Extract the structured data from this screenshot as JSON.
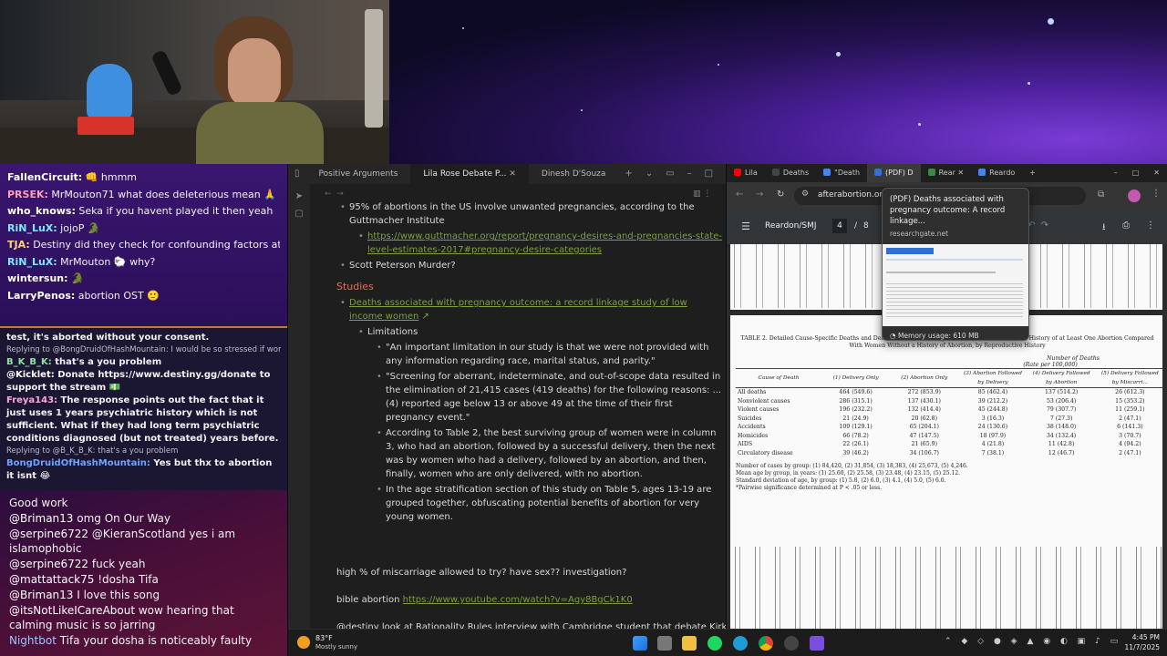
{
  "chat_top": [
    {
      "user": "FallenCircuit:",
      "color": "#ffffff",
      "text": " 👊 hmmm"
    },
    {
      "user": "PRSEK:",
      "color": "#ff9db3",
      "text": " MrMouton71 what does deleterious mean 🙏"
    },
    {
      "user": "who_knows:",
      "color": "#ffffff",
      "text": " Seka if you havent played it then yeah"
    },
    {
      "user": "RiN_LuX:",
      "color": "#7fe8ff",
      "text": " jojoP 🐊"
    },
    {
      "user": "TJA:",
      "color": "#ffd27f",
      "text": " Destiny did they check for confounding factors at all?"
    },
    {
      "user": "RiN_LuX:",
      "color": "#7fe8ff",
      "text": " MrMouton 🐑 why?"
    },
    {
      "user": "wintersun:",
      "color": "#ffffff",
      "text": " 🐊"
    },
    {
      "user": "LarryPenos:",
      "color": "#ffffff",
      "text": " abortion OST 🙂"
    }
  ],
  "chat_mid": [
    {
      "kind": "msg",
      "text": "test, it's aborted without your consent.",
      "color": "#f1f1f1"
    },
    {
      "kind": "reply",
      "text": "Replying to @BongDruidOfHashMountain: I would be so stressed if women d..."
    },
    {
      "kind": "msg",
      "user": "B_K_B_K:",
      "user_color": "#8fe3a0",
      "text": " that's a you problem"
    },
    {
      "kind": "msg",
      "user": "@Kicklet:",
      "user_color": "#ffffff",
      "text": " Donate https://www.destiny.gg/donate to support the stream 💵"
    },
    {
      "kind": "msg",
      "user": "Freya143:",
      "user_color": "#ffa6d8",
      "text": " The response points out the fact that it just uses 1 years psychiatric history which is not sufficient. What if they had long term psychiatric conditions diagnosed (but not treated) years before."
    },
    {
      "kind": "reply",
      "text": "Replying to @B_K_B_K: that's a you problem"
    },
    {
      "kind": "msg",
      "user": "BongDruidOfHashMountain:",
      "user_color": "#6ea4ff",
      "text": " Yes but thx to abortion it isnt 😂"
    }
  ],
  "chat_bottom": [
    {
      "user": "",
      "user_color": "#ffffff",
      "text": "Good work"
    },
    {
      "user": "@Briman13",
      "user_color": "#ffffff",
      "text": " omg On Our Way"
    },
    {
      "user": "@serpine6722",
      "user_color": "#ffffff",
      "text": " @KieranScotland yes i am islamophobic"
    },
    {
      "user": "@serpine6722",
      "user_color": "#ffffff",
      "text": " fuck yeah"
    },
    {
      "user": "@mattattack75",
      "user_color": "#ffffff",
      "text": " !dosha Tifa"
    },
    {
      "user": "@Briman13",
      "user_color": "#ffffff",
      "text": " I love this song"
    },
    {
      "user": "@itsNotLikeICareAbout",
      "user_color": "#ffffff",
      "text": " wow hearing that calming music is so jarring"
    },
    {
      "user": "Nightbot",
      "user_color": "#9cc7ff",
      "text": " Tifa your dosha is noticeably faulty"
    }
  ],
  "obsidian": {
    "tabs": [
      "Positive Arguments",
      "Lila Rose Debate P...",
      "Dinesh D'Souza"
    ],
    "active_tab": 1,
    "line1": "95% of abortions in the US involve unwanted pregnancies, according to the Guttmacher Institute",
    "link1": "https://www.guttmacher.org/report/pregnancy-desires-and-pregnancies-state-level-estimates-2017#pregnancy-desire-categories",
    "line2": "Scott Peterson Murder?",
    "heading": "Studies",
    "study_link": "Deaths associated with pregnancy outcome: a record linkage study of low income women",
    "limitations": "Limitations",
    "lim1": "\"An important limitation in our study is that we were not provided with any information regarding race, marital status, and parity.\"",
    "lim2": "\"Screening for aberrant, indeterminate, and out-of-scope data resulted in the elimination of 21,415 cases (419 deaths) for the following reasons: ...(4) reported age below 13 or above 49 at the time of their first pregnancy event.\"",
    "lim3": "According to Table 2, the best surviving group of women were in column 3, who had an abortion, followed by a successful delivery, then the next was by women who had a delivery, followed by an abortion, and then, finally, women who are only delivered, with no abortion.",
    "lim4": "In the age stratification section of this study on Table 5, ages 13-19 are grouped together, obfuscating potential benefits of abortion for very young women.",
    "para1": "high % of miscarriage allowed to try? have sex?? investigation?",
    "para2_prefix": "bible abortion ",
    "para2_link": "https://www.youtube.com/watch?v=Agy8BgCk1K0",
    "para3": "@destiny look at Rationality Rules interview with Cambridge student that debate Kirk on"
  },
  "chrome": {
    "tabs": [
      "Lila",
      "Deaths",
      "\"Death",
      "(PDF) D",
      "Rear",
      "Reardo"
    ],
    "active_tab": 3,
    "address": "afterabortion.org/",
    "pdf_title": "Reardon/SMJ",
    "page_current": "4",
    "page_sep": "/",
    "page_total": "8",
    "tooltip_title": "(PDF) Deaths associated with pregnancy outcome: A record linkage...",
    "tooltip_domain": "researchgate.net",
    "tooltip_memory": "Memory usage: 610 MB",
    "table_caption": "TABLE 2. Detailed Cause-Specific Deaths and Death Rates in 8 Subsequent Years for Women With a History of at Least One Abortion Compared With Women Without a History of Abortion, by Reproductive History",
    "table_head_group": "Number of Deaths",
    "table_head_sub": "(Rate per 100,000)",
    "table_columns": [
      "Cause of Death",
      "(1) Delivery Only",
      "(2) Abortion Only",
      "(3) Abortion Followed by Delivery",
      "(4) Delivery Followed by Abortion",
      "(5) Delivery Followed by Miscarri..."
    ],
    "table_rows": [
      [
        "All deaths",
        "464 (549.6)",
        "272 (853.9)",
        "85 (462.4)",
        "137 (514.2)",
        "26 (612.3)"
      ],
      [
        "Nonviolent causes",
        "286 (315.1)",
        "137 (430.1)",
        "39 (212.2)",
        "53 (206.4)",
        "15 (353.2)"
      ],
      [
        "Violent causes",
        "196 (232.2)",
        "132 (414.4)",
        "45 (244.8)",
        "79 (307.7)",
        "11 (259.1)"
      ],
      [
        "Suicides",
        "21 (24.9)",
        "20 (62.8)",
        "3 (16.3)",
        "7 (27.3)",
        "2 (47.1)"
      ],
      [
        "Accidents",
        "109 (129.1)",
        "65 (204.1)",
        "24 (130.6)",
        "38 (148.0)",
        "6 (141.3)"
      ],
      [
        "Homicides",
        "66 (78.2)",
        "47 (147.5)",
        "18 (97.9)",
        "34 (132.4)",
        "3 (70.7)"
      ],
      [
        "AIDS",
        "22 (26.1)",
        "21 (65.9)",
        "4 (21.8)",
        "11 (42.8)",
        "4 (94.2)"
      ],
      [
        "Circulatory disease",
        "39 (46.2)",
        "34 (106.7)",
        "7 (38.1)",
        "12 (46.7)",
        "2 (47.1)"
      ]
    ],
    "footnote1": "Number of cases by group: (1) 84,420, (2) 31,854, (3) 18,383, (4) 25,673, (5) 4,246.",
    "footnote2": "Mean age by group, in years: (1) 25.60, (2) 25.58, (3) 23.48, (4) 23.15, (5) 25.12.",
    "footnote3": "Standard deviation of age, by group: (1) 5.8, (2) 6.0, (3) 4.1, (4) 5.0, (5) 6.0.",
    "footnote4": "*Pairwise significance determined at P < .05 or less."
  },
  "taskbar": {
    "weather_temp": "83°F",
    "weather_desc": "Mostly sunny",
    "time": "4:45 PM",
    "date": "11/7/2025"
  }
}
